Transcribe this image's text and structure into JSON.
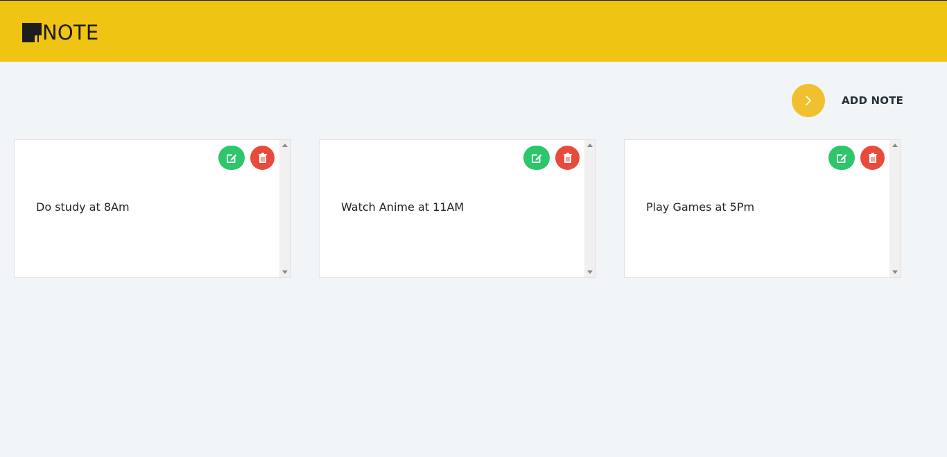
{
  "app": {
    "logo_text": "NOTE"
  },
  "actions": {
    "add_note_label": "ADD NOTE",
    "add_note_icon": "chevron-right-icon"
  },
  "notes": [
    {
      "text": "Do study at 8Am",
      "edit_icon": "edit-icon",
      "delete_icon": "trash-icon"
    },
    {
      "text": "Watch Anime at 11AM",
      "edit_icon": "edit-icon",
      "delete_icon": "trash-icon"
    },
    {
      "text": "Play Games at 5Pm",
      "edit_icon": "edit-icon",
      "delete_icon": "trash-icon"
    }
  ],
  "colors": {
    "header": "#f0c413",
    "add_button": "#f0c02e",
    "edit": "#2dc66a",
    "delete": "#e84b3c",
    "page_background": "#f2f5f7"
  }
}
